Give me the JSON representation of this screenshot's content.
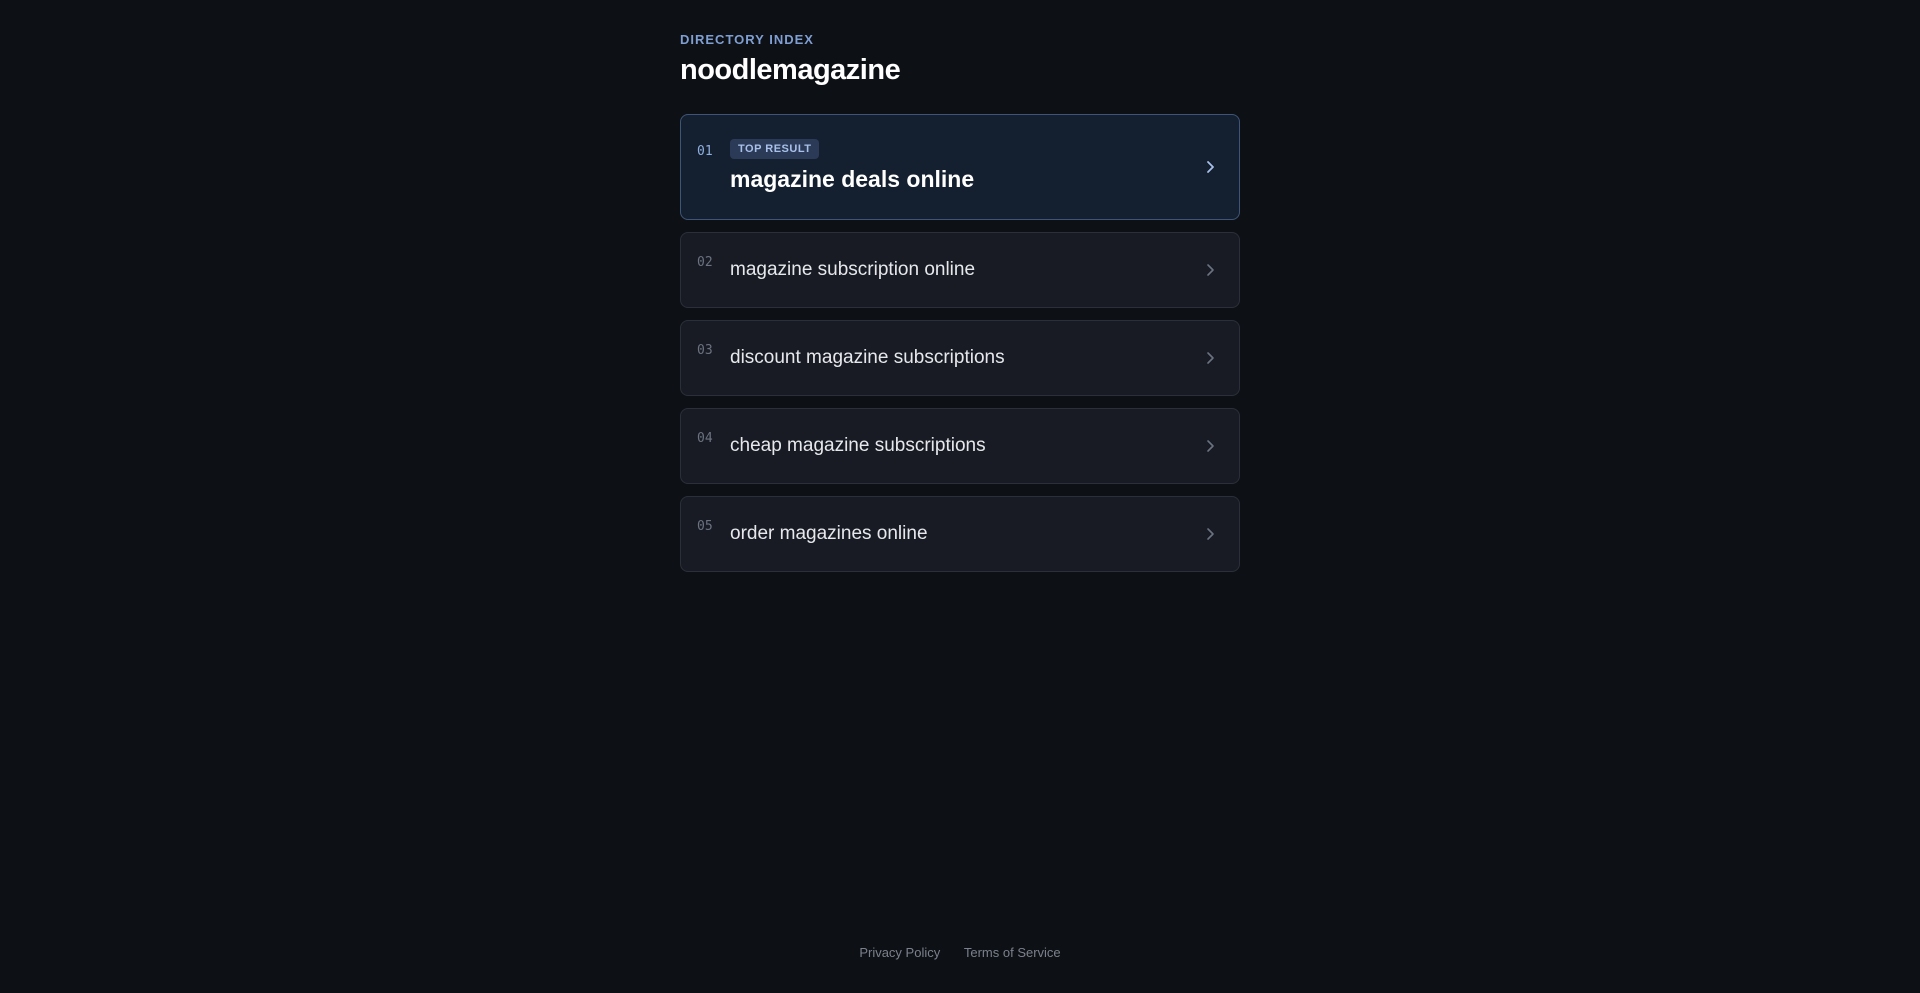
{
  "header": {
    "eyebrow": "DIRECTORY INDEX",
    "title": "noodlemagazine"
  },
  "results": [
    {
      "number": "01",
      "badge": "TOP RESULT",
      "label": "magazine deals online",
      "icon": "chevron-right-icon"
    },
    {
      "number": "02",
      "label": "magazine subscription online",
      "icon": "chevron-right-icon"
    },
    {
      "number": "03",
      "label": "discount magazine subscriptions",
      "icon": "chevron-right-icon"
    },
    {
      "number": "04",
      "label": "cheap magazine subscriptions",
      "icon": "chevron-right-icon"
    },
    {
      "number": "05",
      "label": "order magazines online",
      "icon": "chevron-right-icon"
    }
  ],
  "footer": {
    "privacy": "Privacy Policy",
    "terms": "Terms of Service"
  },
  "colors": {
    "background": "#0d1014",
    "accent": "#7f9fd3",
    "top_card_bg": "#141f30",
    "card_bg": "#181b23"
  }
}
